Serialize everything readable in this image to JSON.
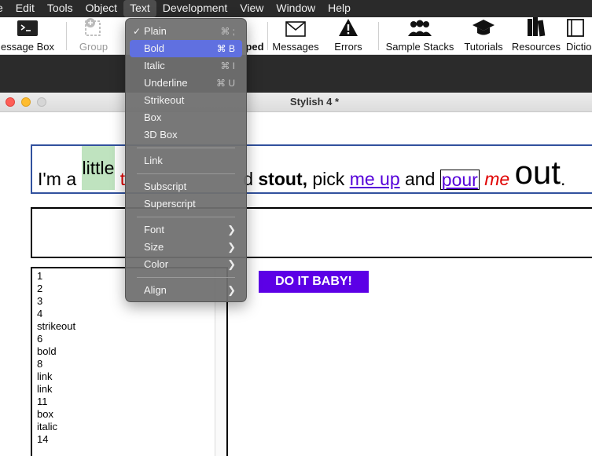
{
  "menubar": {
    "items": [
      "e",
      "Edit",
      "Tools",
      "Object",
      "Text",
      "Development",
      "View",
      "Window",
      "Help"
    ],
    "active_index": 4
  },
  "toolbar": {
    "message_box": "essage Box",
    "group": "Group",
    "ped_fragment": "ped",
    "messages": "Messages",
    "errors": "Errors",
    "sample_stacks": "Sample Stacks",
    "tutorials": "Tutorials",
    "resources": "Resources",
    "dictionary": "Dictio"
  },
  "window": {
    "title": "Stylish 4 *"
  },
  "rich_text": {
    "segments": [
      "I'm a ",
      "little",
      " t",
      "d ",
      "stout,",
      " pick ",
      "me up",
      " and ",
      "pour",
      " ",
      "me",
      " ",
      "out",
      "."
    ]
  },
  "list": {
    "lines": [
      "1",
      "2",
      "3",
      "4",
      "strikeout",
      "6",
      "bold",
      "8",
      "link",
      "link",
      "11",
      "box",
      "italic",
      "14"
    ]
  },
  "button": {
    "label": "DO IT BABY!"
  },
  "text_menu": {
    "plain": "Plain",
    "plain_key": "⌘ ;",
    "bold": "Bold",
    "bold_key": "⌘ B",
    "italic": "Italic",
    "italic_key": "⌘ I",
    "underline": "Underline",
    "underline_key": "⌘ U",
    "strikeout": "Strikeout",
    "box": "Box",
    "box3d": "3D Box",
    "link": "Link",
    "subscript": "Subscript",
    "superscript": "Superscript",
    "font": "Font",
    "size": "Size",
    "color": "Color",
    "align": "Align",
    "checked_item": "Plain",
    "highlighted_item": "Bold"
  },
  "colors": {
    "accent_button": "#5c00e6",
    "link": "#5500d9",
    "red_text": "#e00000",
    "highlight_green": "#bfe3bf",
    "menu_highlight": "#6070e0"
  },
  "icons": {
    "message_box": "terminal-icon",
    "group": "group-icon",
    "messages": "envelope-icon",
    "errors": "warning-icon",
    "sample_stacks": "people-icon",
    "tutorials": "graduation-cap-icon",
    "resources": "books-icon",
    "dictionary": "book-icon"
  }
}
